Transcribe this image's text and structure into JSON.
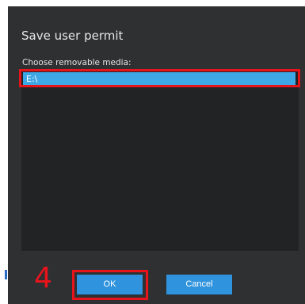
{
  "dialog": {
    "title": "Save user permit",
    "media_label": "Choose removable media:",
    "media_items": [
      "E:\\"
    ],
    "selected_item": "E:\\",
    "ok_label": "OK",
    "cancel_label": "Cancel"
  },
  "annotation": {
    "step_number": "4"
  },
  "colors": {
    "dialog_bg": "#2f3032",
    "list_bg": "#222325",
    "selection": "#3ea7e6",
    "button": "#2f93dd",
    "annotation_red": "#e8141c"
  }
}
